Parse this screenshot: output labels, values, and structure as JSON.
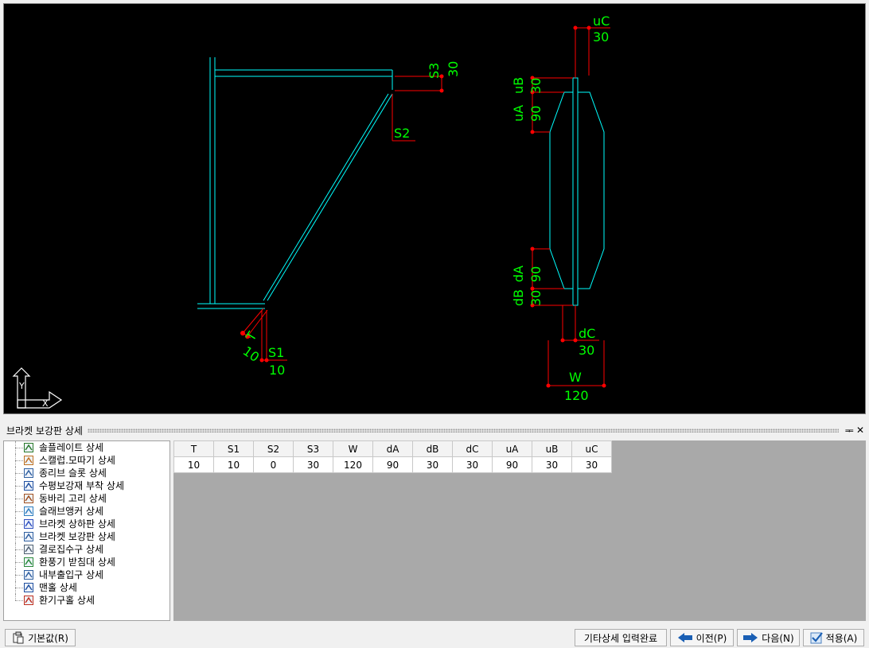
{
  "cad": {
    "dim_labels": {
      "s3": "S3",
      "s3_val": "30",
      "s2": "S2",
      "t": "T",
      "t_val": "10",
      "s1": "S1",
      "s1_val": "10",
      "uc": "uC",
      "uc_val": "30",
      "ub": "uB",
      "ub_val": "30",
      "ua": "uA",
      "ua_val": "90",
      "da": "dA",
      "da_val": "90",
      "db": "dB",
      "db_val": "30",
      "dc": "dC",
      "dc_val": "30",
      "w": "W",
      "w_val": "120"
    },
    "axis_labels": {
      "y": "Y",
      "x": "X"
    },
    "colors": {
      "geometry": "#00ffff",
      "dimension_line": "#ff0000",
      "dimension_text": "#00ff00",
      "background": "#000000"
    }
  },
  "panel": {
    "title": "브라켓 보강판 상세",
    "pin_label": "ᆍ",
    "close_label": "✕"
  },
  "tree": {
    "items": [
      {
        "label": "솔플레이트 상세",
        "icon": "sole-plate-icon"
      },
      {
        "label": "스캘럽.모따기 상세",
        "icon": "scallop-icon"
      },
      {
        "label": "종리브 슬롯 상세",
        "icon": "rib-slot-icon"
      },
      {
        "label": "수평보강재 부착 상세",
        "icon": "stiffener-icon"
      },
      {
        "label": "동바리 고리 상세",
        "icon": "hook-icon"
      },
      {
        "label": "슬래브앵커 상세",
        "icon": "anchor-icon"
      },
      {
        "label": "브라켓 상하판 상세",
        "icon": "bracket-flange-icon"
      },
      {
        "label": "브라켓 보강판 상세",
        "icon": "bracket-stiffener-icon"
      },
      {
        "label": "결로집수구 상세",
        "icon": "drain-icon"
      },
      {
        "label": "환풍기 받침대 상세",
        "icon": "fan-support-icon"
      },
      {
        "label": "내부출입구 상세",
        "icon": "door-icon"
      },
      {
        "label": "맨홀 상세",
        "icon": "manhole-icon"
      },
      {
        "label": "환기구홀 상세",
        "icon": "vent-hole-icon"
      }
    ]
  },
  "table": {
    "headers": [
      "T",
      "S1",
      "S2",
      "S3",
      "W",
      "dA",
      "dB",
      "dC",
      "uA",
      "uB",
      "uC"
    ],
    "values": [
      "10",
      "10",
      "0",
      "30",
      "120",
      "90",
      "30",
      "30",
      "90",
      "30",
      "30"
    ]
  },
  "buttons": {
    "default": "기본값(R)",
    "complete": "기타상세 입력완료",
    "prev": "이전(P)",
    "next": "다음(N)",
    "apply": "적용(A)"
  }
}
